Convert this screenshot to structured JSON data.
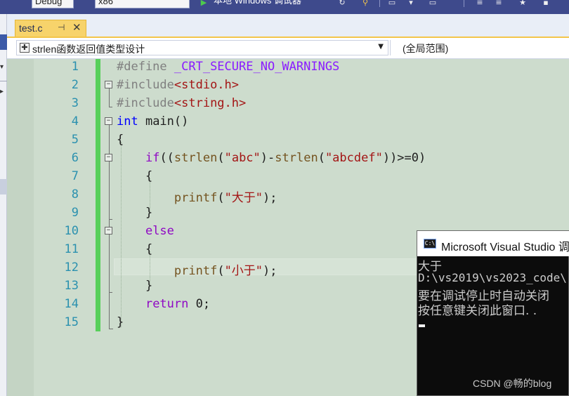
{
  "toolbar": {
    "config_value": "Debug",
    "platform_value": "x86",
    "run_label": "本地 Windows 调试器"
  },
  "tab": {
    "title": "test.c",
    "pin_icon": "pin-icon",
    "close_icon": "close-icon"
  },
  "nav": {
    "scope_project": "strlen函数返回值类型设计",
    "scope_global": "(全局范围)"
  },
  "editor": {
    "line_numbers": [
      "1",
      "2",
      "3",
      "4",
      "5",
      "6",
      "7",
      "8",
      "9",
      "10",
      "11",
      "12",
      "13",
      "14",
      "15"
    ],
    "lines": [
      [
        {
          "t": "#define ",
          "c": "pp"
        },
        {
          "t": "_CRT_SECURE_NO_WARNINGS",
          "c": "mac"
        }
      ],
      [
        {
          "t": "#include",
          "c": "pp"
        },
        {
          "t": "<stdio.h>",
          "c": "str"
        }
      ],
      [
        {
          "t": "#include",
          "c": "pp"
        },
        {
          "t": "<string.h>",
          "c": "str"
        }
      ],
      [
        {
          "t": "int",
          "c": "kw"
        },
        {
          "t": " main()",
          "c": "op"
        }
      ],
      [
        {
          "t": "{",
          "c": "op"
        }
      ],
      [
        {
          "t": "    ",
          "c": "op"
        },
        {
          "t": "if",
          "c": "ctl"
        },
        {
          "t": "((",
          "c": "op"
        },
        {
          "t": "strlen",
          "c": "fn"
        },
        {
          "t": "(",
          "c": "op"
        },
        {
          "t": "\"abc\"",
          "c": "str"
        },
        {
          "t": ")-",
          "c": "op"
        },
        {
          "t": "strlen",
          "c": "fn"
        },
        {
          "t": "(",
          "c": "op"
        },
        {
          "t": "\"abcdef\"",
          "c": "str"
        },
        {
          "t": "))>=0)",
          "c": "op"
        }
      ],
      [
        {
          "t": "    {",
          "c": "op"
        }
      ],
      [
        {
          "t": "        ",
          "c": "op"
        },
        {
          "t": "printf",
          "c": "fn"
        },
        {
          "t": "(",
          "c": "op"
        },
        {
          "t": "\"大于\"",
          "c": "str"
        },
        {
          "t": ");",
          "c": "op"
        }
      ],
      [
        {
          "t": "    }",
          "c": "op"
        }
      ],
      [
        {
          "t": "    ",
          "c": "op"
        },
        {
          "t": "else",
          "c": "ctl"
        }
      ],
      [
        {
          "t": "    {",
          "c": "op"
        }
      ],
      [
        {
          "t": "        ",
          "c": "op"
        },
        {
          "t": "printf",
          "c": "fn"
        },
        {
          "t": "(",
          "c": "op"
        },
        {
          "t": "\"小于\"",
          "c": "str"
        },
        {
          "t": ");",
          "c": "op"
        }
      ],
      [
        {
          "t": "    }",
          "c": "op"
        }
      ],
      [
        {
          "t": "    ",
          "c": "op"
        },
        {
          "t": "return",
          "c": "ctl"
        },
        {
          "t": " 0;",
          "c": "op"
        }
      ],
      [
        {
          "t": "}",
          "c": "op"
        }
      ]
    ]
  },
  "console": {
    "title": "Microsoft Visual Studio 调",
    "output": [
      "大于",
      "D:\\vs2019\\vs2023_code\\",
      "要在调试停止时自动关闭",
      "按任意键关闭此窗口. ."
    ],
    "watermark": "CSDN @畅的blog"
  }
}
